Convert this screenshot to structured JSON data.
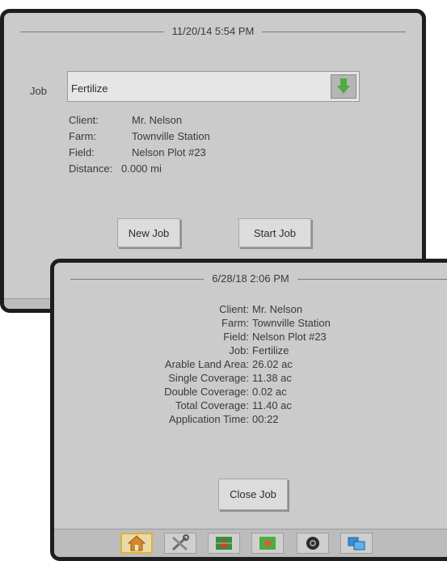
{
  "job_screen": {
    "datetime": "11/20/14 5:54 PM",
    "job_label": "Job",
    "job_value": "Fertilize",
    "dropdown_icon": "green-down-arrow-icon",
    "details": [
      {
        "key": "Client:",
        "value": "Mr. Nelson"
      },
      {
        "key": "Farm:",
        "value": "Townville Station"
      },
      {
        "key": "Field:",
        "value": "Nelson Plot #23"
      },
      {
        "key": "Distance:",
        "value": "0.000 mi"
      }
    ],
    "new_job_label": "New Job",
    "start_job_label": "Start Job"
  },
  "summary_screen": {
    "datetime": "6/28/18 2:06 PM",
    "rows": [
      {
        "label": "Client:",
        "value": "Mr. Nelson"
      },
      {
        "label": "Farm:",
        "value": "Townville Station"
      },
      {
        "label": "Field:",
        "value": "Nelson Plot #23"
      },
      {
        "label": "Job:",
        "value": "Fertilize"
      },
      {
        "label": "Arable Land Area:",
        "value": "26.02 ac"
      },
      {
        "label": "Single Coverage:",
        "value": "11.38 ac"
      },
      {
        "label": "Double Coverage:",
        "value": "0.02 ac"
      },
      {
        "label": "Total Coverage:",
        "value": "11.40 ac"
      },
      {
        "label": "Application Time:",
        "value": "00:22"
      }
    ],
    "close_job_label": "Close Job"
  },
  "toolbar": {
    "items": [
      {
        "name": "home",
        "icon": "home-icon",
        "active": true
      },
      {
        "name": "tools",
        "icon": "tools-icon",
        "active": false
      },
      {
        "name": "vehicle-view",
        "icon": "vehicle-view-icon",
        "active": false
      },
      {
        "name": "field-map",
        "icon": "field-map-icon",
        "active": false
      },
      {
        "name": "camera",
        "icon": "camera-icon",
        "active": false
      },
      {
        "name": "data-transfer",
        "icon": "data-transfer-icon",
        "active": false
      }
    ]
  },
  "colors": {
    "panel_bg": "#cbcbcb",
    "bezel": "#1d1d1d",
    "accent_green": "#4cae3c",
    "active_border": "#d8b23c"
  }
}
